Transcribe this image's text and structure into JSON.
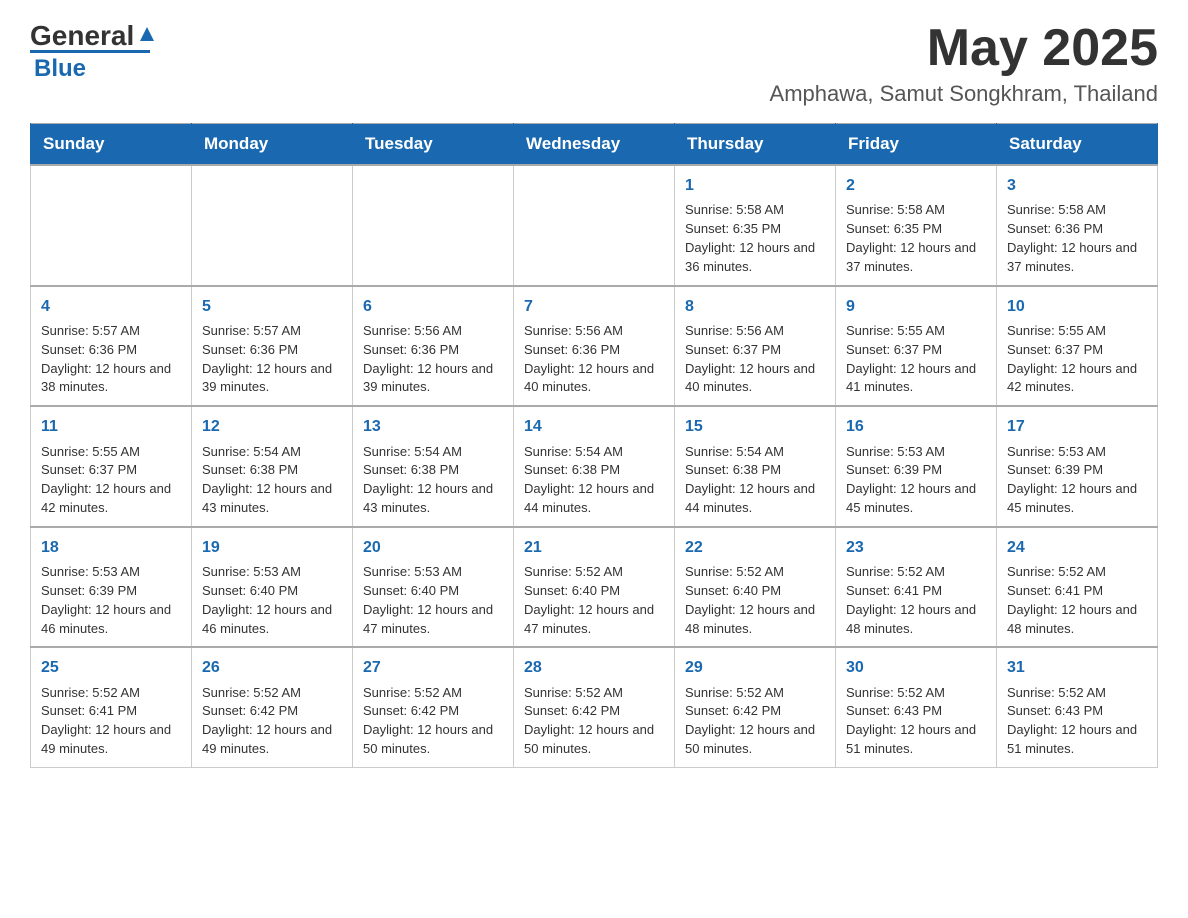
{
  "header": {
    "logo_general": "General",
    "logo_blue": "Blue",
    "month_title": "May 2025",
    "subtitle": "Amphawa, Samut Songkhram, Thailand"
  },
  "days_of_week": [
    "Sunday",
    "Monday",
    "Tuesday",
    "Wednesday",
    "Thursday",
    "Friday",
    "Saturday"
  ],
  "weeks": [
    [
      {
        "day": "",
        "info": ""
      },
      {
        "day": "",
        "info": ""
      },
      {
        "day": "",
        "info": ""
      },
      {
        "day": "",
        "info": ""
      },
      {
        "day": "1",
        "info": "Sunrise: 5:58 AM\nSunset: 6:35 PM\nDaylight: 12 hours and 36 minutes."
      },
      {
        "day": "2",
        "info": "Sunrise: 5:58 AM\nSunset: 6:35 PM\nDaylight: 12 hours and 37 minutes."
      },
      {
        "day": "3",
        "info": "Sunrise: 5:58 AM\nSunset: 6:36 PM\nDaylight: 12 hours and 37 minutes."
      }
    ],
    [
      {
        "day": "4",
        "info": "Sunrise: 5:57 AM\nSunset: 6:36 PM\nDaylight: 12 hours and 38 minutes."
      },
      {
        "day": "5",
        "info": "Sunrise: 5:57 AM\nSunset: 6:36 PM\nDaylight: 12 hours and 39 minutes."
      },
      {
        "day": "6",
        "info": "Sunrise: 5:56 AM\nSunset: 6:36 PM\nDaylight: 12 hours and 39 minutes."
      },
      {
        "day": "7",
        "info": "Sunrise: 5:56 AM\nSunset: 6:36 PM\nDaylight: 12 hours and 40 minutes."
      },
      {
        "day": "8",
        "info": "Sunrise: 5:56 AM\nSunset: 6:37 PM\nDaylight: 12 hours and 40 minutes."
      },
      {
        "day": "9",
        "info": "Sunrise: 5:55 AM\nSunset: 6:37 PM\nDaylight: 12 hours and 41 minutes."
      },
      {
        "day": "10",
        "info": "Sunrise: 5:55 AM\nSunset: 6:37 PM\nDaylight: 12 hours and 42 minutes."
      }
    ],
    [
      {
        "day": "11",
        "info": "Sunrise: 5:55 AM\nSunset: 6:37 PM\nDaylight: 12 hours and 42 minutes."
      },
      {
        "day": "12",
        "info": "Sunrise: 5:54 AM\nSunset: 6:38 PM\nDaylight: 12 hours and 43 minutes."
      },
      {
        "day": "13",
        "info": "Sunrise: 5:54 AM\nSunset: 6:38 PM\nDaylight: 12 hours and 43 minutes."
      },
      {
        "day": "14",
        "info": "Sunrise: 5:54 AM\nSunset: 6:38 PM\nDaylight: 12 hours and 44 minutes."
      },
      {
        "day": "15",
        "info": "Sunrise: 5:54 AM\nSunset: 6:38 PM\nDaylight: 12 hours and 44 minutes."
      },
      {
        "day": "16",
        "info": "Sunrise: 5:53 AM\nSunset: 6:39 PM\nDaylight: 12 hours and 45 minutes."
      },
      {
        "day": "17",
        "info": "Sunrise: 5:53 AM\nSunset: 6:39 PM\nDaylight: 12 hours and 45 minutes."
      }
    ],
    [
      {
        "day": "18",
        "info": "Sunrise: 5:53 AM\nSunset: 6:39 PM\nDaylight: 12 hours and 46 minutes."
      },
      {
        "day": "19",
        "info": "Sunrise: 5:53 AM\nSunset: 6:40 PM\nDaylight: 12 hours and 46 minutes."
      },
      {
        "day": "20",
        "info": "Sunrise: 5:53 AM\nSunset: 6:40 PM\nDaylight: 12 hours and 47 minutes."
      },
      {
        "day": "21",
        "info": "Sunrise: 5:52 AM\nSunset: 6:40 PM\nDaylight: 12 hours and 47 minutes."
      },
      {
        "day": "22",
        "info": "Sunrise: 5:52 AM\nSunset: 6:40 PM\nDaylight: 12 hours and 48 minutes."
      },
      {
        "day": "23",
        "info": "Sunrise: 5:52 AM\nSunset: 6:41 PM\nDaylight: 12 hours and 48 minutes."
      },
      {
        "day": "24",
        "info": "Sunrise: 5:52 AM\nSunset: 6:41 PM\nDaylight: 12 hours and 48 minutes."
      }
    ],
    [
      {
        "day": "25",
        "info": "Sunrise: 5:52 AM\nSunset: 6:41 PM\nDaylight: 12 hours and 49 minutes."
      },
      {
        "day": "26",
        "info": "Sunrise: 5:52 AM\nSunset: 6:42 PM\nDaylight: 12 hours and 49 minutes."
      },
      {
        "day": "27",
        "info": "Sunrise: 5:52 AM\nSunset: 6:42 PM\nDaylight: 12 hours and 50 minutes."
      },
      {
        "day": "28",
        "info": "Sunrise: 5:52 AM\nSunset: 6:42 PM\nDaylight: 12 hours and 50 minutes."
      },
      {
        "day": "29",
        "info": "Sunrise: 5:52 AM\nSunset: 6:42 PM\nDaylight: 12 hours and 50 minutes."
      },
      {
        "day": "30",
        "info": "Sunrise: 5:52 AM\nSunset: 6:43 PM\nDaylight: 12 hours and 51 minutes."
      },
      {
        "day": "31",
        "info": "Sunrise: 5:52 AM\nSunset: 6:43 PM\nDaylight: 12 hours and 51 minutes."
      }
    ]
  ]
}
